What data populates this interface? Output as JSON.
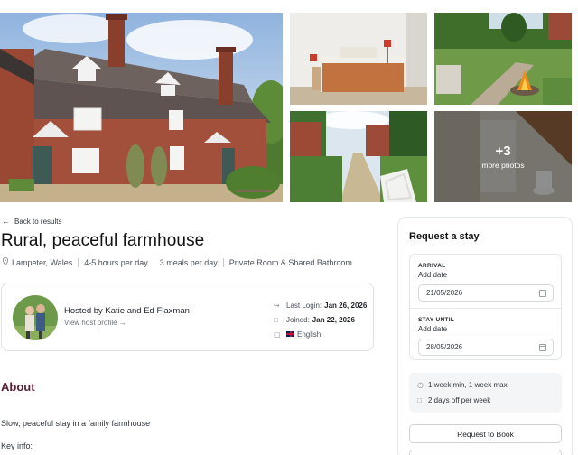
{
  "gallery": {
    "more_count": "+3",
    "more_label": "more photos"
  },
  "back_link": "Back to results",
  "listing": {
    "title": "Rural, peaceful farmhouse",
    "location": "Lampeter, Wales",
    "hours": "4-5 hours per day",
    "meals": "3 meals per day",
    "room": "Private Room & Shared Bathroom"
  },
  "host": {
    "name": "Hosted by Katie and Ed Flaxman",
    "profile_link": "View host profile →",
    "last_login_label": "Last Login:",
    "last_login_value": "Jan 26, 2026",
    "joined_label": "Joined:",
    "joined_value": "Jan 22, 2026",
    "language": "English"
  },
  "about": {
    "heading": "About",
    "text": "Slow, peaceful stay in a family farmhouse",
    "key_info": "Key info:"
  },
  "booking": {
    "title": "Request a stay",
    "arrival_label": "ARRIVAL",
    "arrival_sub": "Add date",
    "arrival_value": "21/05/2026",
    "until_label": "STAY UNTIL",
    "until_sub": "Add date",
    "until_value": "28/05/2026",
    "rule_duration": "1 week min, 1 week max",
    "rule_days_off": "2 days off per week",
    "request_button": "Request to Book"
  },
  "colors": {
    "about_heading": "#5a1f33",
    "border": "#dfe2e6"
  },
  "icons": [
    "arrow-left-icon",
    "location-pin-icon",
    "login-icon",
    "calendar-icon",
    "chat-icon",
    "uk-flag-icon",
    "clock-icon",
    "chevron-right-icon"
  ]
}
